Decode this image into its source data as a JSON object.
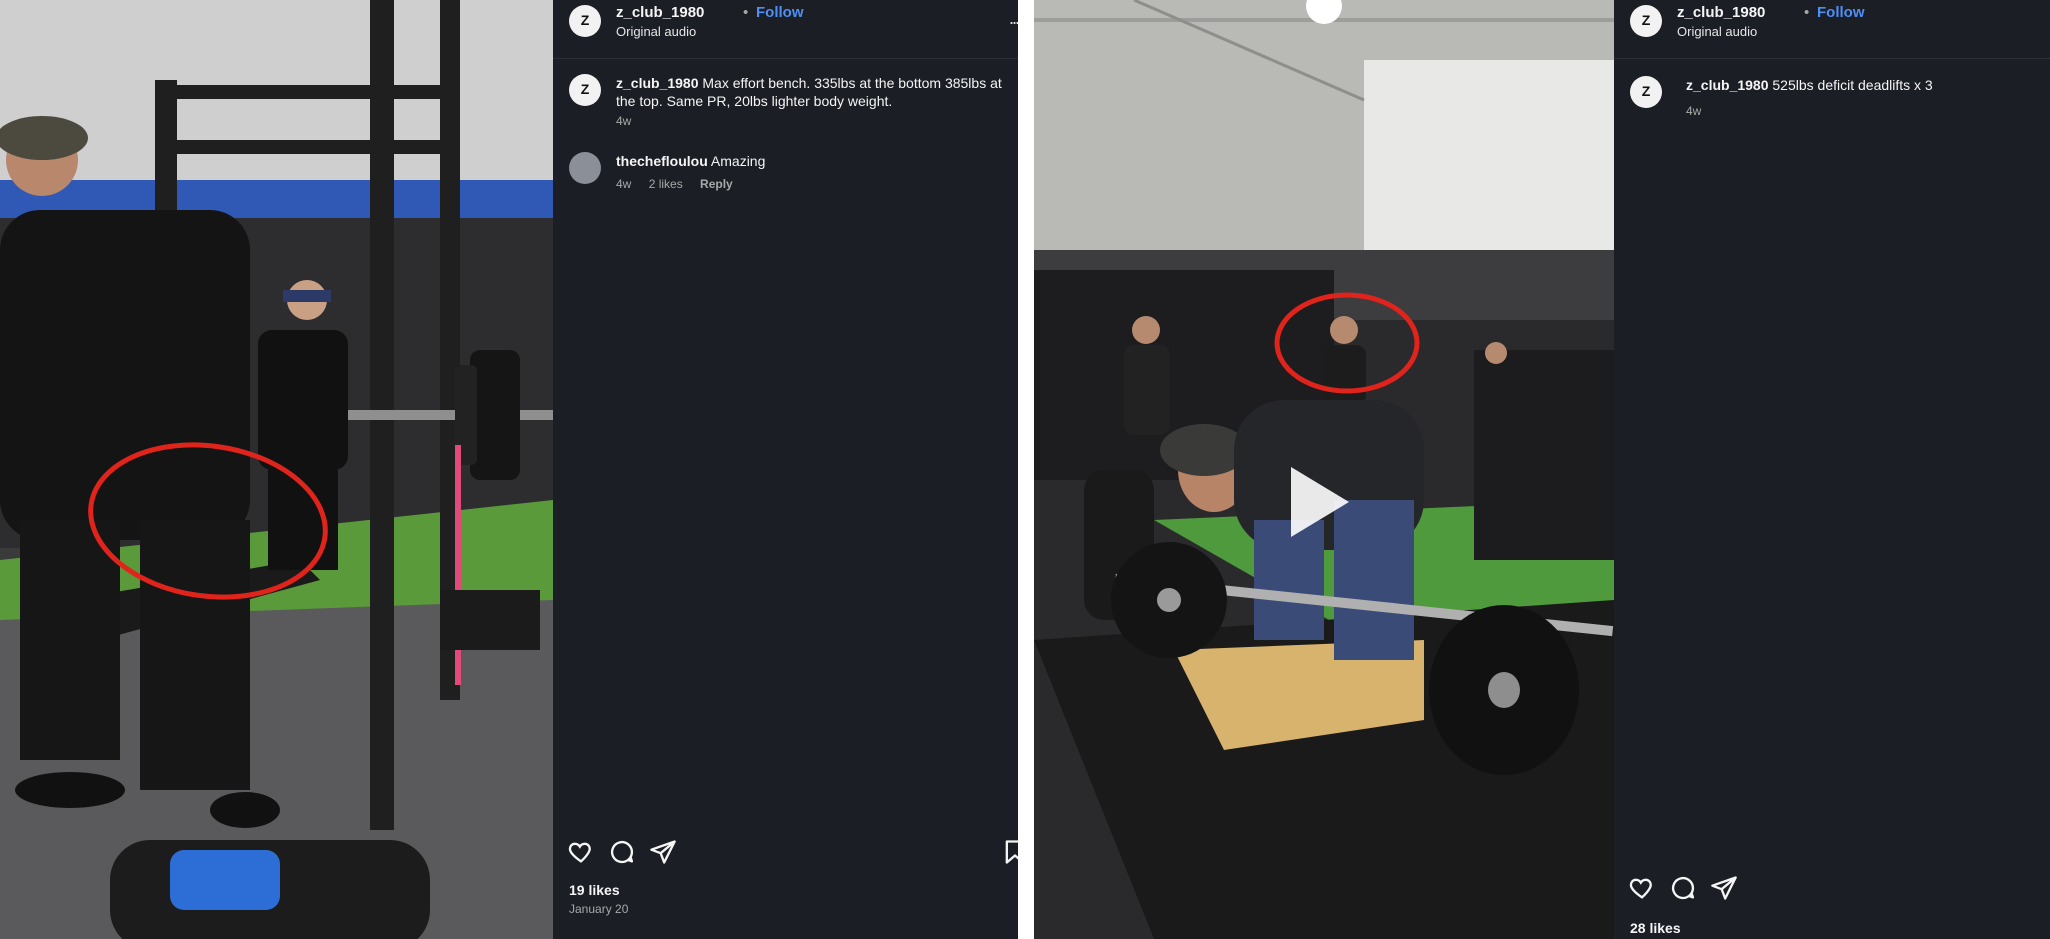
{
  "colors": {
    "panel_bg": "#1b1e24",
    "follow_link": "#4e8ff5",
    "annotation_circle": "#e0241b",
    "meta_text": "#a8a8a8"
  },
  "posts": [
    {
      "username": "z_club_1980",
      "separator": "•",
      "follow": "Follow",
      "audio": "Original audio",
      "more": "...",
      "avatar_text": "Z",
      "caption": {
        "username": "z_club_1980",
        "text": "Max effort bench. 335lbs at the bottom 385lbs at the top. Same PR, 20lbs lighter body weight.",
        "time": "4w"
      },
      "comments": [
        {
          "username": "thechefloulou",
          "text": "Amazing",
          "time": "4w",
          "likes": "2 likes",
          "reply": "Reply"
        }
      ],
      "actions": {
        "like": "heart-icon",
        "comment": "comment-bubble-icon",
        "share": "paper-plane-icon",
        "save": "bookmark-icon"
      },
      "likes": "19 likes",
      "date": "January 20"
    },
    {
      "username": "z_club_1980",
      "separator": "•",
      "follow": "Follow",
      "audio": "Original audio",
      "avatar_text": "Z",
      "caption": {
        "username": "z_club_1980",
        "text": "525lbs deficit deadlifts x 3",
        "time": "4w"
      },
      "actions": {
        "like": "heart-icon",
        "comment": "comment-bubble-icon",
        "share": "paper-plane-icon"
      },
      "likes": "28 likes",
      "video_overlay": "play-icon"
    }
  ]
}
